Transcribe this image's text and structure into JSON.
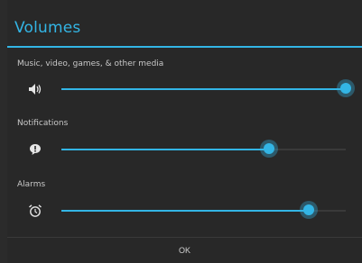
{
  "dialog": {
    "title": "Volumes",
    "ok_label": "OK"
  },
  "sliders": [
    {
      "label": "Music, video, games, & other media",
      "icon": "speaker-volume-icon",
      "value": 1.0
    },
    {
      "label": "Notifications",
      "icon": "notification-bubble-icon",
      "value": 0.73
    },
    {
      "label": "Alarms",
      "icon": "alarm-clock-icon",
      "value": 0.87
    }
  ],
  "colors": {
    "accent": "#33b5e5",
    "background": "#282828",
    "track": "#3a3a3a"
  }
}
